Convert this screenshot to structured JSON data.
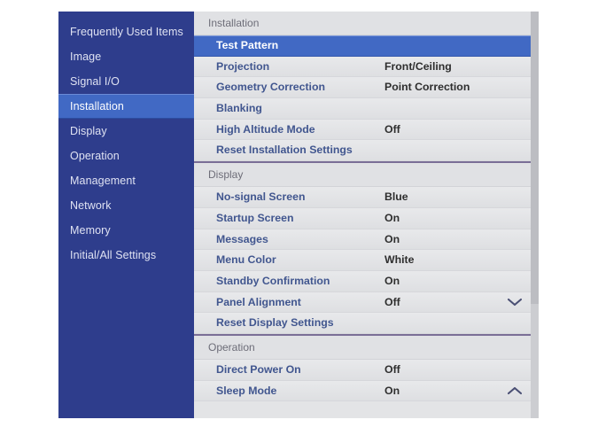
{
  "sidebar": {
    "items": [
      {
        "label": "Frequently Used Items",
        "selected": false
      },
      {
        "label": "Image",
        "selected": false
      },
      {
        "label": "Signal I/O",
        "selected": false
      },
      {
        "label": "Installation",
        "selected": true
      },
      {
        "label": "Display",
        "selected": false
      },
      {
        "label": "Operation",
        "selected": false
      },
      {
        "label": "Management",
        "selected": false
      },
      {
        "label": "Network",
        "selected": false
      },
      {
        "label": "Memory",
        "selected": false
      },
      {
        "label": "Initial/All Settings",
        "selected": false
      }
    ]
  },
  "panel": {
    "sections": [
      {
        "header": "Installation",
        "rows": [
          {
            "label": "Test Pattern",
            "value": "",
            "selected": true,
            "chevron": ""
          },
          {
            "label": "Projection",
            "value": "Front/Ceiling",
            "selected": false,
            "chevron": ""
          },
          {
            "label": "Geometry Correction",
            "value": "Point Correction",
            "selected": false,
            "chevron": ""
          },
          {
            "label": "Blanking",
            "value": "",
            "selected": false,
            "chevron": ""
          },
          {
            "label": "High Altitude Mode",
            "value": "Off",
            "selected": false,
            "chevron": ""
          },
          {
            "label": "Reset Installation Settings",
            "value": "",
            "selected": false,
            "chevron": ""
          }
        ]
      },
      {
        "header": "Display",
        "rows": [
          {
            "label": "No-signal Screen",
            "value": "Blue",
            "selected": false,
            "chevron": ""
          },
          {
            "label": "Startup Screen",
            "value": "On",
            "selected": false,
            "chevron": ""
          },
          {
            "label": "Messages",
            "value": "On",
            "selected": false,
            "chevron": ""
          },
          {
            "label": "Menu Color",
            "value": "White",
            "selected": false,
            "chevron": ""
          },
          {
            "label": "Standby Confirmation",
            "value": "On",
            "selected": false,
            "chevron": ""
          },
          {
            "label": "Panel Alignment",
            "value": "Off",
            "selected": false,
            "chevron": "down"
          },
          {
            "label": "Reset Display Settings",
            "value": "",
            "selected": false,
            "chevron": ""
          }
        ]
      },
      {
        "header": "Operation",
        "rows": [
          {
            "label": "Direct Power On",
            "value": "Off",
            "selected": false,
            "chevron": ""
          },
          {
            "label": "Sleep Mode",
            "value": "On",
            "selected": false,
            "chevron": "up"
          }
        ]
      }
    ]
  },
  "colors": {
    "sidebar_background": "#2e3d8c",
    "selection_blue": "#4169c4",
    "panel_background": "#e3e4e6",
    "label_blue": "#41568f",
    "section_divider": "#7a6e96",
    "value_text": "#2e2e2e"
  },
  "scrollbar": {
    "visible": true
  }
}
